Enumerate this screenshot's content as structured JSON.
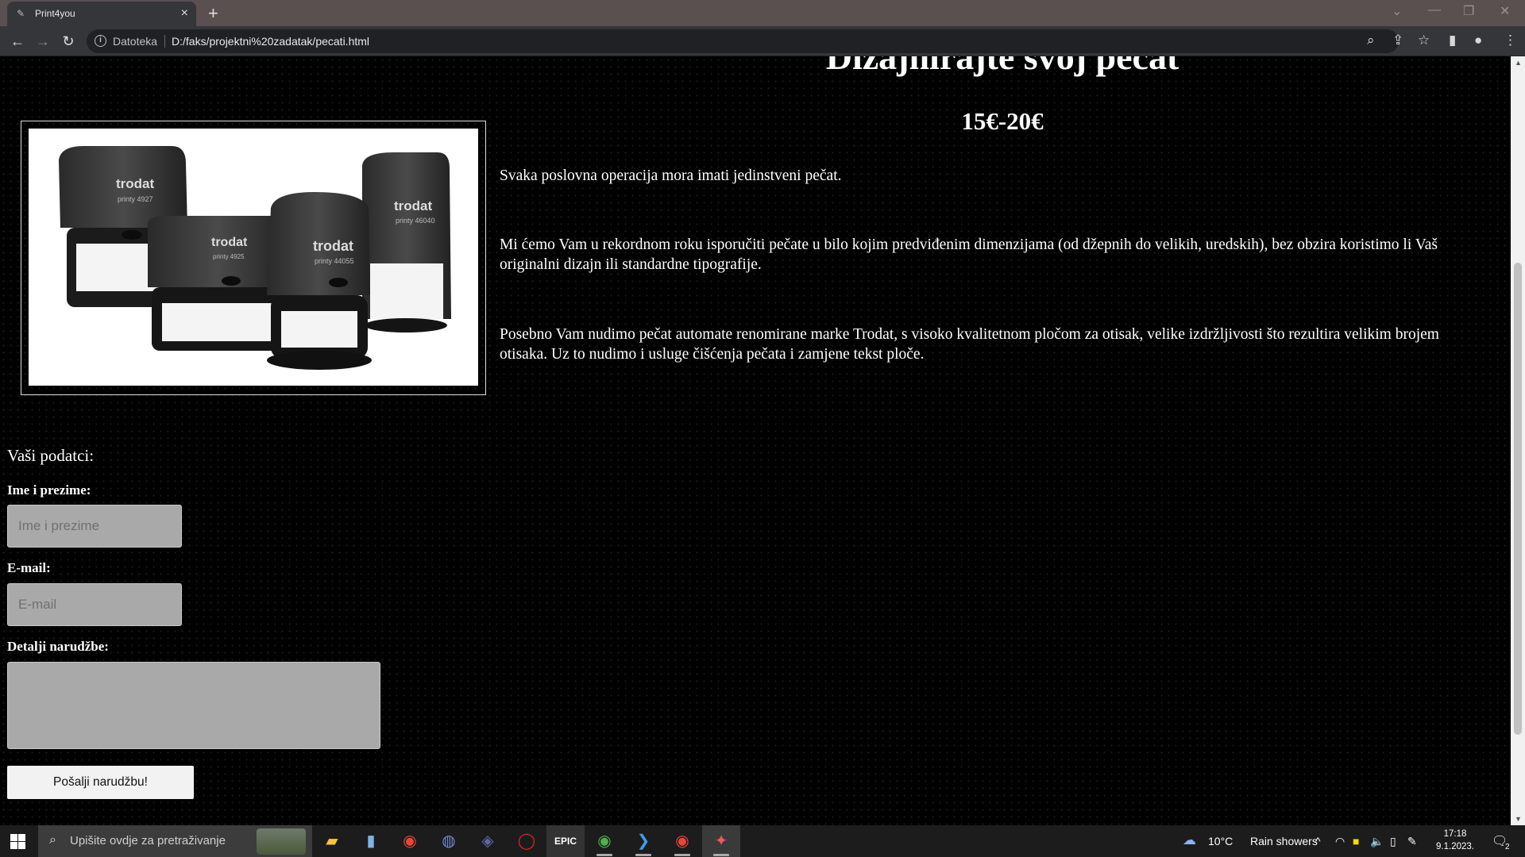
{
  "browser": {
    "tab_title": "Print4you",
    "scheme_label": "Datoteka",
    "url": "D:/faks/projektni%20zadatak/pecati.html"
  },
  "page": {
    "heading": "Dizajnirajte svoj pečat",
    "price": "15€-20€",
    "paragraphs": [
      "Svaka poslovna operacija mora imati jedinstveni pečat.",
      "Mi ćemo Vam u rekordnom roku isporučiti pečate u bilo kojim predviđenim dimenzijama (od džepnih do velikih, uredskih), bez obzira koristimo li Vaš originalni dizajn ili standardne tipografije.",
      "Posebno Vam nudimo pečat automate renomirane marke Trodat, s visoko kvalitetnom pločom za otisak, velike izdržljivosti što rezultira velikim brojem otisaka. Uz to nudimo i usluge čišćenja pečata i zamjene tekst ploče."
    ],
    "product_image": {
      "brand": "trodat",
      "models": [
        "printy 4927",
        "printy 4925",
        "printy 44055",
        "printy 46040"
      ]
    }
  },
  "form": {
    "title": "Vaši podatci:",
    "name_label": "Ime i prezime:",
    "name_placeholder": "Ime i prezime",
    "email_label": "E-mail:",
    "email_placeholder": "E-mail",
    "details_label": "Detalji narudžbe:",
    "submit_label": "Pošalji narudžbu!"
  },
  "taskbar": {
    "search_placeholder": "Upišite ovdje za pretraživanje",
    "weather_temp": "10°C",
    "weather_text": "Rain showers",
    "time": "17:18",
    "date": "9.1.2023.",
    "notification_count": "2"
  }
}
